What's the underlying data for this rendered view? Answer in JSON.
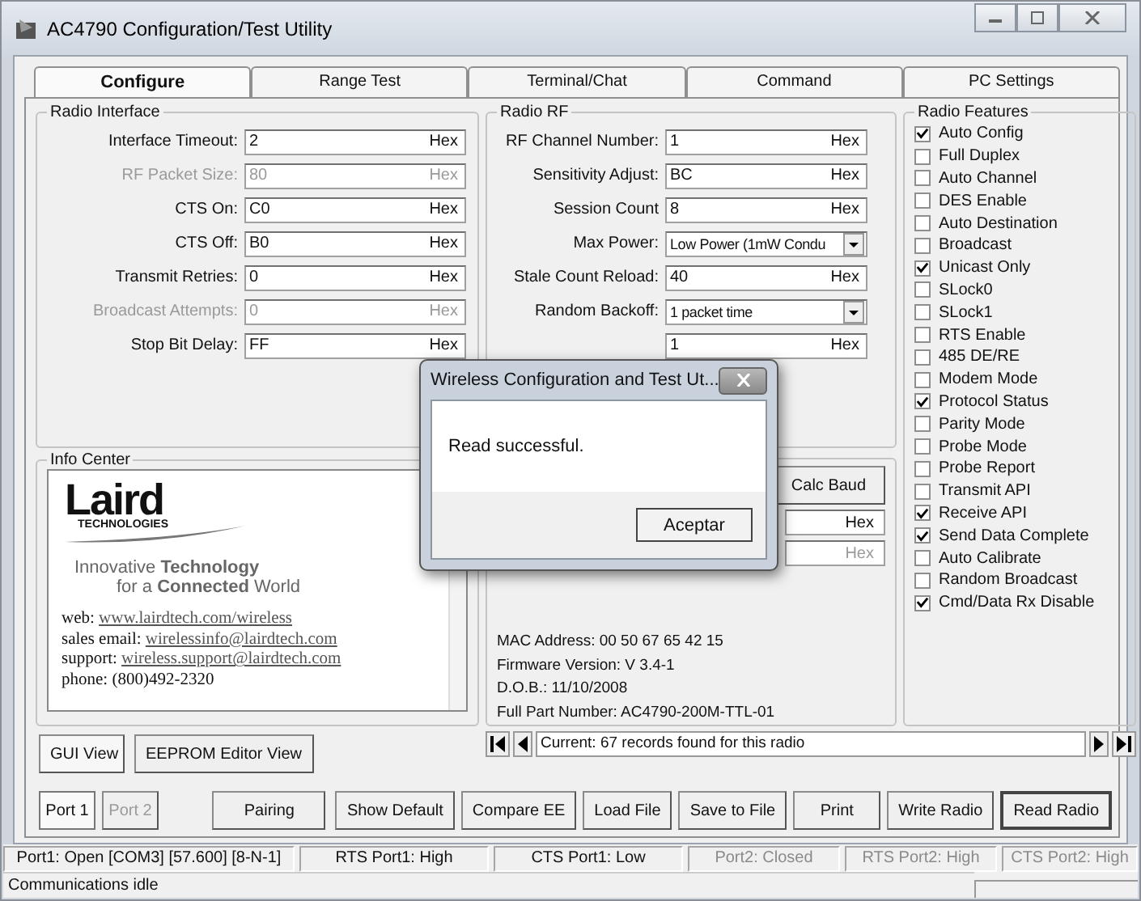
{
  "window": {
    "title": "AC4790 Configuration/Test Utility"
  },
  "tabs": [
    {
      "label": "Configure",
      "selected": true
    },
    {
      "label": "Range Test",
      "selected": false
    },
    {
      "label": "Terminal/Chat",
      "selected": false
    },
    {
      "label": "Command",
      "selected": false
    },
    {
      "label": "PC Settings",
      "selected": false
    }
  ],
  "radio_interface": {
    "title": "Radio Interface",
    "rows": [
      {
        "label": "Interface Timeout:",
        "value": "2",
        "unit": "Hex",
        "disabled": false
      },
      {
        "label": "RF Packet Size:",
        "value": "80",
        "unit": "Hex",
        "disabled": true
      },
      {
        "label": "CTS On:",
        "value": "C0",
        "unit": "Hex",
        "disabled": false
      },
      {
        "label": "CTS Off:",
        "value": "B0",
        "unit": "Hex",
        "disabled": false
      },
      {
        "label": "Transmit Retries:",
        "value": "0",
        "unit": "Hex",
        "disabled": false
      },
      {
        "label": "Broadcast Attempts:",
        "value": "0",
        "unit": "Hex",
        "disabled": true
      },
      {
        "label": "Stop Bit Delay:",
        "value": "FF",
        "unit": "Hex",
        "disabled": false
      }
    ]
  },
  "radio_rf": {
    "title": "Radio RF",
    "rows": [
      {
        "kind": "field",
        "label": "RF Channel Number:",
        "value": "1",
        "unit": "Hex"
      },
      {
        "kind": "field",
        "label": "Sensitivity Adjust:",
        "value": "BC",
        "unit": "Hex"
      },
      {
        "kind": "field",
        "label": "Session Count",
        "value": "8",
        "unit": "Hex"
      },
      {
        "kind": "dropdown",
        "label": "Max Power:",
        "value": "Low Power (1mW Condu"
      },
      {
        "kind": "field",
        "label": "Stale Count Reload:",
        "value": "40",
        "unit": "Hex"
      },
      {
        "kind": "dropdown",
        "label": "Random Backoff:",
        "value": "1 packet time"
      },
      {
        "kind": "field",
        "value": "1",
        "unit": "Hex"
      }
    ]
  },
  "radio_features": {
    "title": "Radio Features",
    "items": [
      {
        "label": "Auto Config",
        "checked": true
      },
      {
        "label": "Full Duplex",
        "checked": false
      },
      {
        "label": "Auto Channel",
        "checked": false
      },
      {
        "label": "DES Enable",
        "checked": false
      },
      {
        "label": "Auto Destination",
        "checked": false
      },
      {
        "label": "Broadcast",
        "checked": false
      },
      {
        "label": "Unicast Only",
        "checked": true
      },
      {
        "label": "SLock0",
        "checked": false
      },
      {
        "label": "SLock1",
        "checked": false
      },
      {
        "label": "RTS Enable",
        "checked": false
      },
      {
        "label": "485 DE/RE",
        "checked": false
      },
      {
        "label": "Modem Mode",
        "checked": false
      },
      {
        "label": "Protocol Status",
        "checked": true
      },
      {
        "label": "Parity Mode",
        "checked": false
      },
      {
        "label": "Probe Mode",
        "checked": false
      },
      {
        "label": "Probe Report",
        "checked": false
      },
      {
        "label": "Transmit API",
        "checked": false
      },
      {
        "label": "Receive API",
        "checked": true
      },
      {
        "label": "Send Data Complete",
        "checked": true
      },
      {
        "label": "Auto Calibrate",
        "checked": false
      },
      {
        "label": "Random Broadcast",
        "checked": false
      },
      {
        "label": "Cmd/Data Rx Disable",
        "checked": true
      }
    ]
  },
  "info_center": {
    "title": "Info Center",
    "logo": "Laird",
    "logo_subtitle": "TECHNOLOGIES",
    "tagline": [
      "Innovative **Technology**",
      "for a **Connected** World"
    ],
    "lines": [
      {
        "label": "web:",
        "link": "www.lairdtech.com/wireless"
      },
      {
        "label": "sales email:",
        "link": "wirelessinfo@lairdtech.com"
      },
      {
        "label": "support:",
        "link": "wireless.support@lairdtech.com"
      },
      {
        "label": "phone:",
        "text": "(800)492-2320"
      }
    ]
  },
  "device_info": {
    "button": "Calc Baud",
    "fields": [
      {
        "unit": "Hex",
        "disabled": false
      },
      {
        "unit": "Hex",
        "disabled": true
      }
    ],
    "lines": [
      "MAC Address:  00 50 67 65 42 15",
      "Firmware Version:  V 3.4-1",
      "D.O.B.:  11/10/2008",
      "Full Part Number: AC4790-200M-TTL-01"
    ]
  },
  "view_buttons": [
    {
      "label": "GUI View",
      "selected": true
    },
    {
      "label": "EEPROM Editor View",
      "selected": false
    }
  ],
  "records": {
    "value": "Current: 67 records found for this radio"
  },
  "port_buttons": [
    {
      "label": "Port 1",
      "selected": true,
      "disabled": false
    },
    {
      "label": "Port 2",
      "selected": false,
      "disabled": true
    }
  ],
  "action_buttons": [
    "Pairing",
    "Show Default",
    "Compare EE",
    "Load File",
    "Save to File",
    "Print",
    "Write Radio",
    "Read Radio"
  ],
  "status_bar": [
    {
      "text": "Port1: Open  [COM3] [57.600] [8-N-1]",
      "disabled": false
    },
    {
      "text": "RTS Port1: High",
      "disabled": false
    },
    {
      "text": "CTS Port1: Low",
      "disabled": false
    },
    {
      "text": "Port2: Closed",
      "disabled": true
    },
    {
      "text": "RTS Port2: High",
      "disabled": true
    },
    {
      "text": "CTS Port2: High",
      "disabled": true
    }
  ],
  "status_message": "Communications idle",
  "dialog": {
    "title": "Wireless Configuration and Test Ut...",
    "message": "Read successful.",
    "button": "Aceptar"
  }
}
